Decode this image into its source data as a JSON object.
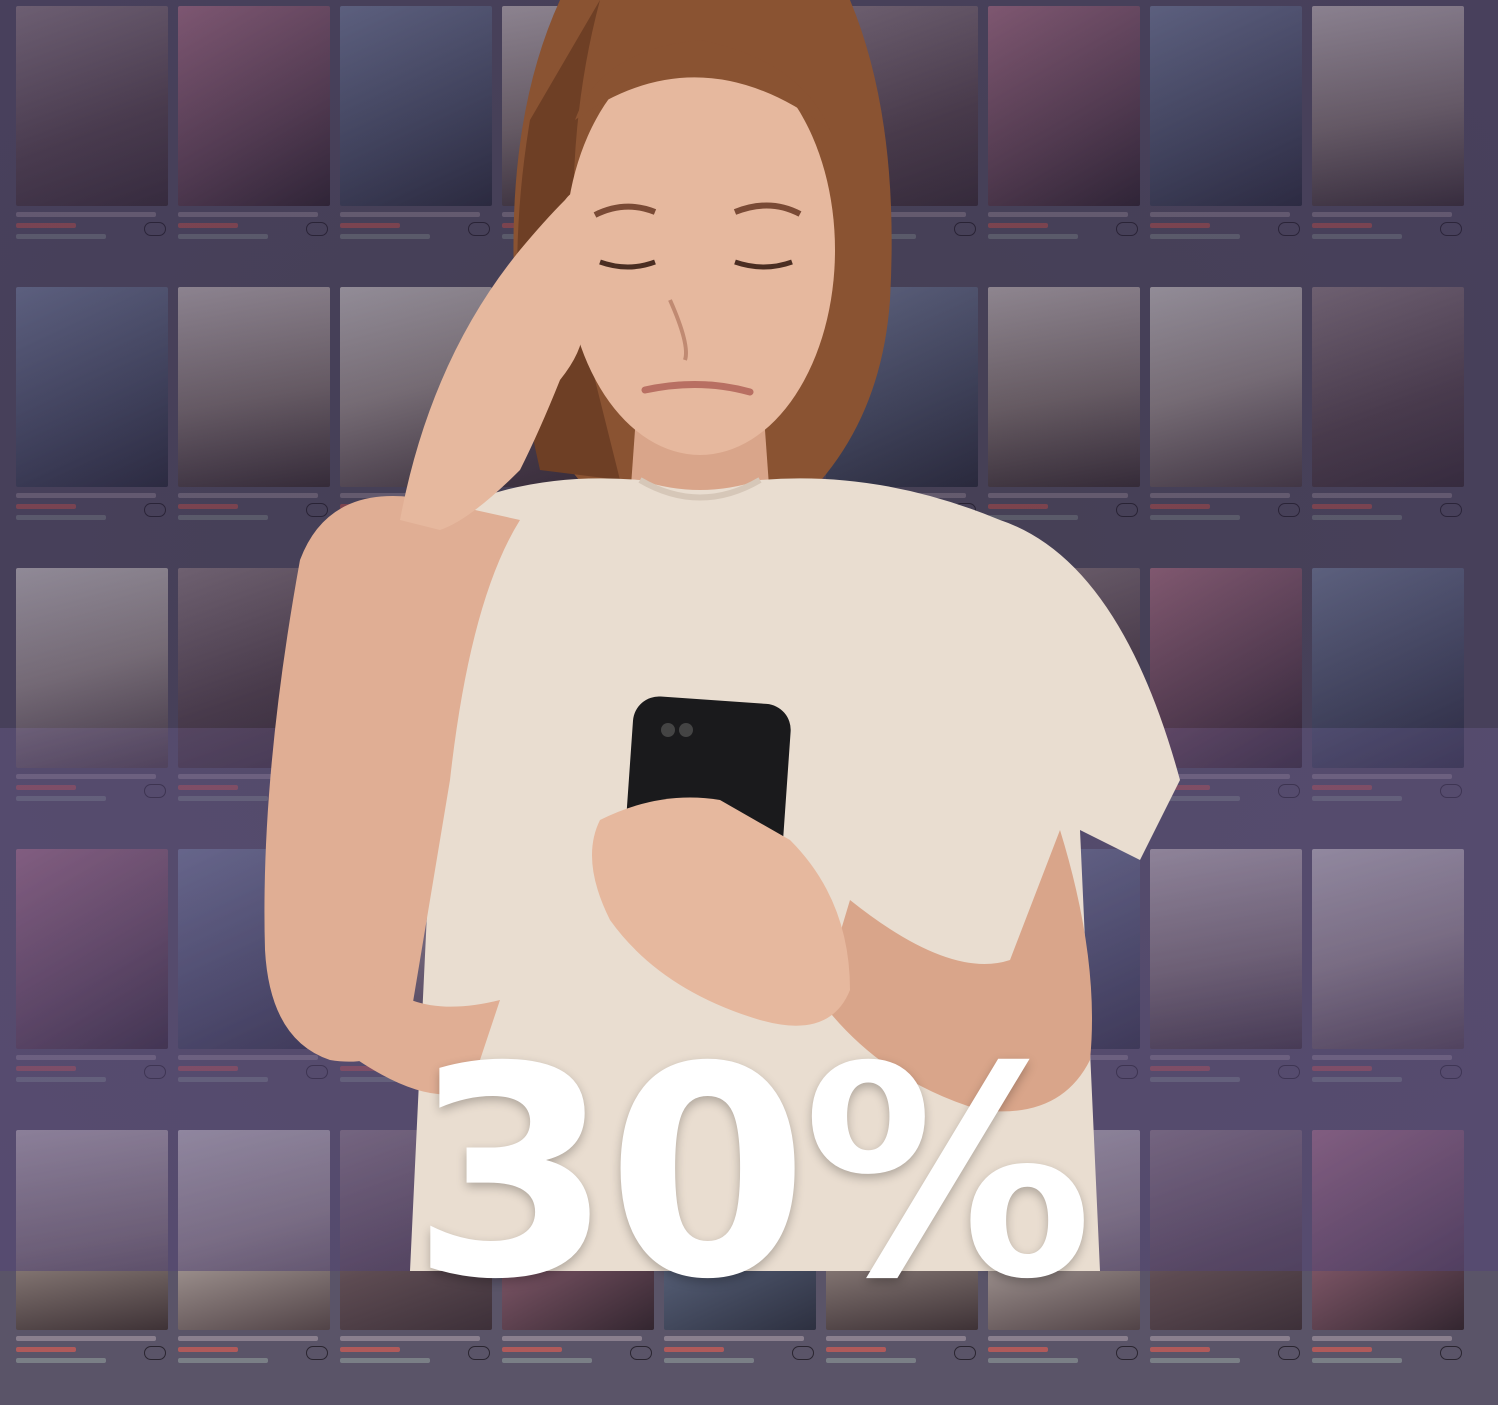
{
  "headline": {
    "value": "30%"
  },
  "product_grid": {
    "rows": 5,
    "columns": 9
  },
  "colors": {
    "overlay": "#5a5468",
    "headline": "#ffffff",
    "shirt": "#e9ddd0",
    "hair": "#8a5332",
    "phone": "#1a1a1c"
  }
}
